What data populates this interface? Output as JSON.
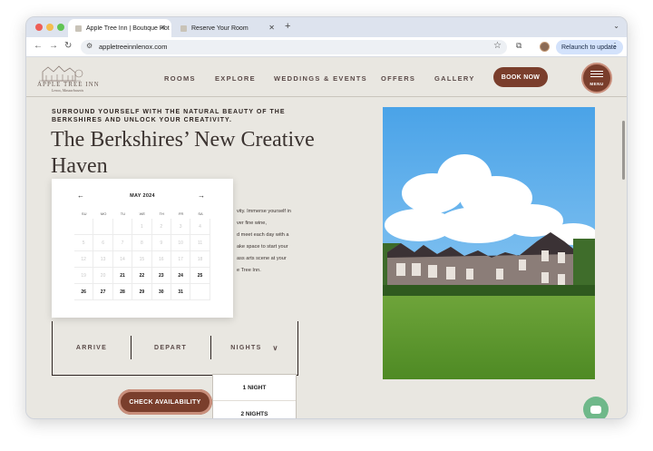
{
  "browser": {
    "tabs": [
      {
        "label": "Apple Tree Inn | Boutique Hot"
      },
      {
        "label": "Reserve Your Room"
      }
    ],
    "url": "appletreeinnlenox.com",
    "relaunch_label": "Relaunch to update"
  },
  "site": {
    "logo": {
      "brand": "APPLE TREE INN",
      "sub": "Lenox, Massachusetts"
    },
    "nav": [
      "ROOMS",
      "EXPLORE",
      "WEDDINGS & EVENTS",
      "OFFERS",
      "GALLERY"
    ],
    "book_now": "BOOK NOW",
    "menu_label": "MENU",
    "tagline": "SURROUND YOURSELF WITH THE NATURAL BEAUTY OF THE BERKSHIRES AND UNLOCK YOUR CREATIVITY.",
    "headline": "The Berkshires’ New Creative Haven",
    "body_lines": [
      "vity. Immerse yourself in",
      "ver fine wine,",
      "d meet each day with a",
      "ake space to start your",
      "ass arts scene at your",
      "e Tree Inn."
    ]
  },
  "calendar": {
    "month": "MAY 2024",
    "weekdays": [
      "SU",
      "MO",
      "TU",
      "WE",
      "TH",
      "FR",
      "SA"
    ],
    "weeks": [
      [
        "",
        "",
        "",
        "1",
        "2",
        "3",
        "4"
      ],
      [
        "5",
        "6",
        "7",
        "8",
        "9",
        "10",
        "11"
      ],
      [
        "12",
        "13",
        "14",
        "15",
        "16",
        "17",
        "18"
      ],
      [
        "19",
        "20",
        "21",
        "22",
        "23",
        "24",
        "25"
      ],
      [
        "26",
        "27",
        "28",
        "29",
        "30",
        "31",
        ""
      ]
    ],
    "first_available_day": 21
  },
  "booking": {
    "arrive": "ARRIVE",
    "depart": "DEPART",
    "nights": "NIGHTS",
    "nights_options": [
      "1 NIGHT",
      "2 NIGHTS"
    ],
    "check_availability": "CHECK AVAILABILITY"
  },
  "colors": {
    "brand": "#7a3e2c",
    "background": "#e9e7e1",
    "text_dark": "#3b3330"
  },
  "icons": [
    "back-icon",
    "forward-icon",
    "reload-icon",
    "star-icon",
    "extensions-icon",
    "profile-icon",
    "more-icon",
    "calendar-prev-icon",
    "calendar-next-icon",
    "chevron-down-icon",
    "chat-icon"
  ]
}
